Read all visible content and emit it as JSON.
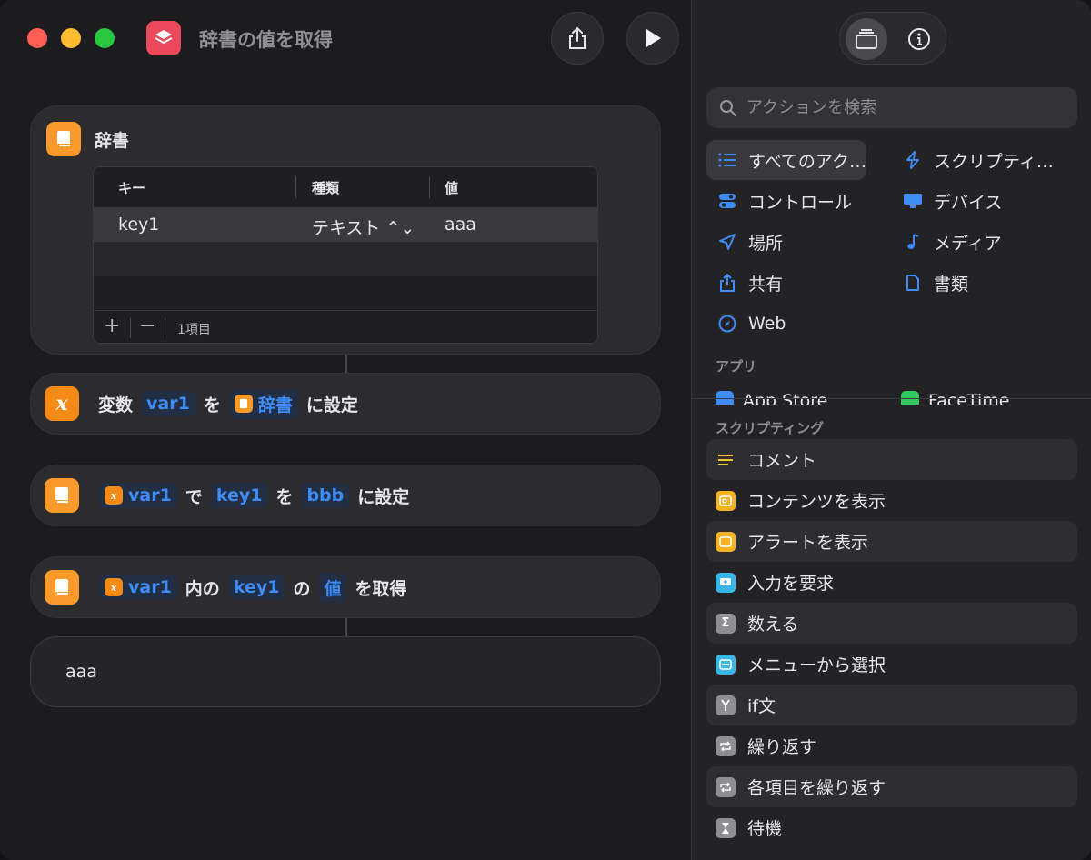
{
  "window": {
    "title": "辞書の値を取得"
  },
  "dictionary": {
    "title": "辞書",
    "columns": {
      "key": "キー",
      "type": "種類",
      "value": "値"
    },
    "rows": [
      {
        "key": "key1",
        "type": "テキスト ⌃⌄",
        "value": "aaa"
      }
    ],
    "add": "+",
    "remove": "−",
    "count": "1項目"
  },
  "set_variable": {
    "prefix": "変数",
    "var": "var1",
    "particle": "を",
    "value": "辞書",
    "suffix": "に設定"
  },
  "set_dict_value": {
    "var": "var1",
    "p1": "で",
    "key": "key1",
    "p2": "を",
    "value": "bbb",
    "suffix": "に設定"
  },
  "get_dict_value": {
    "var": "var1",
    "p1": "内の",
    "key": "key1",
    "p2": "の",
    "value": "値",
    "suffix": "を取得"
  },
  "result": {
    "text": "aaa"
  },
  "sidebar": {
    "search_placeholder": "アクションを検索",
    "categories": {
      "all": "すべてのアク…",
      "scripting": "スクリプティ…",
      "control": "コントロール",
      "device": "デバイス",
      "location": "場所",
      "media": "メディア",
      "share": "共有",
      "documents": "書類",
      "web": "Web"
    },
    "apps_label": "アプリ",
    "apps": {
      "app_store": "App Store",
      "facetime": "FaceTime"
    },
    "scripting_label": "スクリプティング",
    "actions": [
      "コメント",
      "コンテンツを表示",
      "アラートを表示",
      "入力を要求",
      "数える",
      "メニューから選択",
      "if文",
      "繰り返す",
      "各項目を繰り返す",
      "待機"
    ]
  }
}
